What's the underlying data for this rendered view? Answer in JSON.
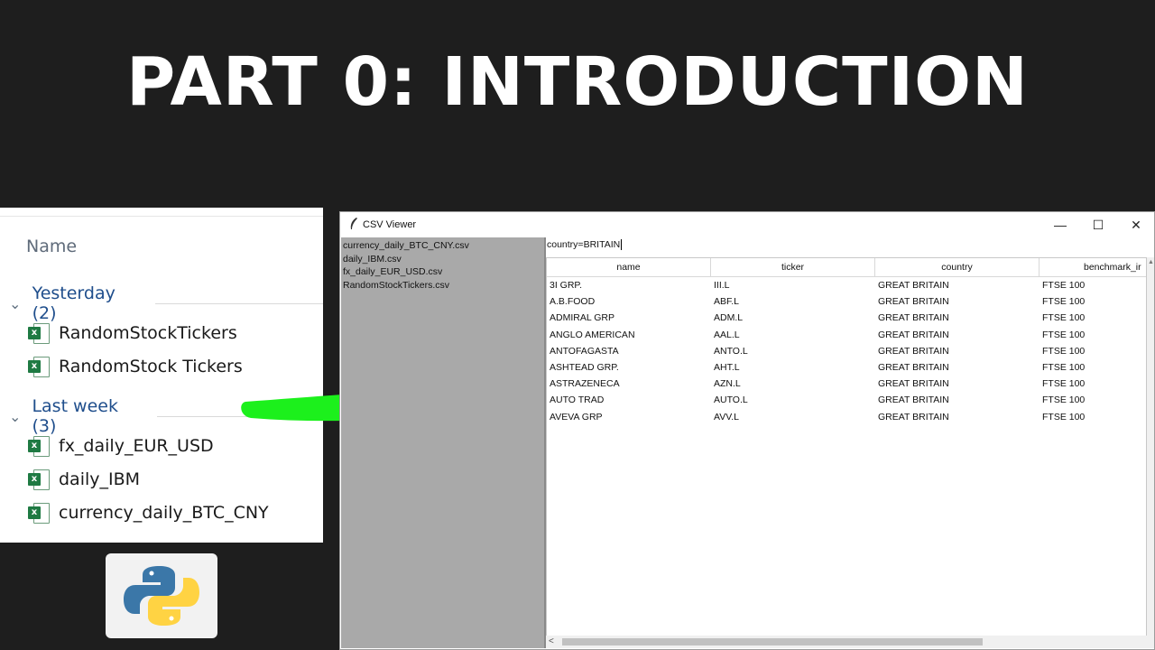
{
  "headline": "PART 0: INTRODUCTION",
  "explorer": {
    "column_header": "Name",
    "groups": [
      {
        "label": "Yesterday (2)",
        "files": [
          "RandomStockTickers",
          "RandomStock Tickers"
        ]
      },
      {
        "label": "Last week (3)",
        "files": [
          "fx_daily_EUR_USD",
          "daily_IBM",
          "currency_daily_BTC_CNY"
        ]
      }
    ],
    "file_icon_letter": "x"
  },
  "window": {
    "title": "CSV Viewer",
    "controls": {
      "minimize": "—",
      "maximize": "☐",
      "close": "✕"
    },
    "files": [
      "currency_daily_BTC_CNY.csv",
      "daily_IBM.csv",
      "fx_daily_EUR_USD.csv",
      "RandomStockTickers.csv"
    ],
    "filter_value": "country=BRITAIN",
    "table": {
      "headers": [
        "name",
        "ticker",
        "country",
        "benchmark_ir"
      ],
      "rows": [
        [
          "3I GRP.",
          "III.L",
          "GREAT BRITAIN",
          "FTSE 100"
        ],
        [
          "A.B.FOOD",
          "ABF.L",
          "GREAT BRITAIN",
          "FTSE 100"
        ],
        [
          "ADMIRAL GRP",
          "ADM.L",
          "GREAT BRITAIN",
          "FTSE 100"
        ],
        [
          "ANGLO AMERICAN",
          "AAL.L",
          "GREAT BRITAIN",
          "FTSE 100"
        ],
        [
          "ANTOFAGASTA",
          "ANTO.L",
          "GREAT BRITAIN",
          "FTSE 100"
        ],
        [
          "ASHTEAD GRP.",
          "AHT.L",
          "GREAT BRITAIN",
          "FTSE 100"
        ],
        [
          "ASTRAZENECA",
          "AZN.L",
          "GREAT BRITAIN",
          "FTSE 100"
        ],
        [
          "AUTO TRAD",
          "AUTO.L",
          "GREAT BRITAIN",
          "FTSE 100"
        ],
        [
          "AVEVA GRP",
          "AVV.L",
          "GREAT BRITAIN",
          "FTSE 100"
        ]
      ]
    }
  },
  "colors": {
    "background": "#1e1e1e",
    "arrow": "#1cf01c",
    "sidebar": "#a9a9a9",
    "group_label": "#1f4e8c",
    "excel_green": "#1f7a43",
    "python_blue": "#3b77a8",
    "python_yellow": "#ffd343"
  },
  "icons": [
    "excel-file-icon",
    "python-logo-icon",
    "feather-icon",
    "green-arrow"
  ]
}
